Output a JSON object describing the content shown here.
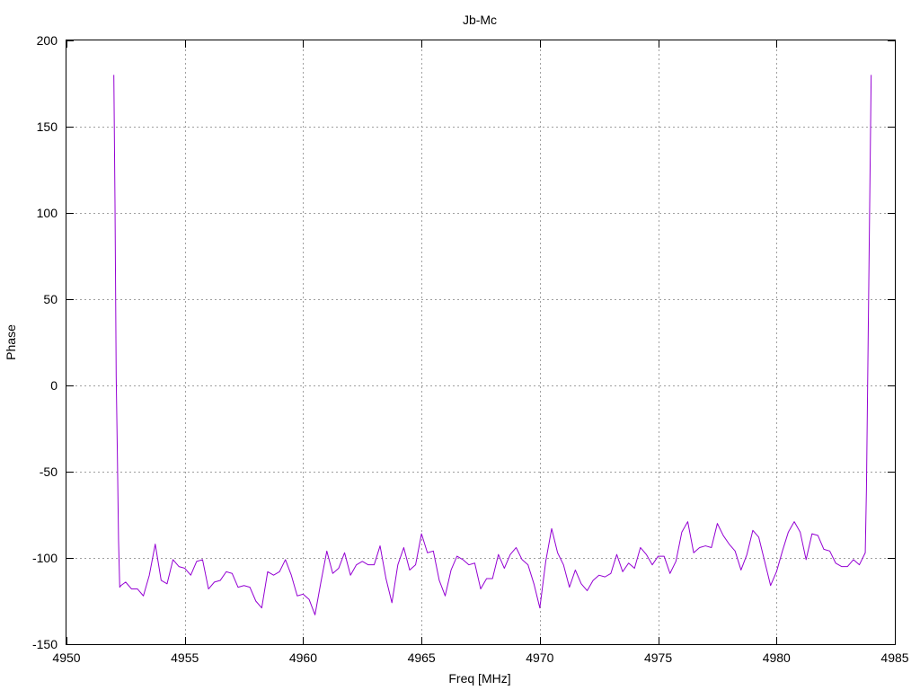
{
  "chart_data": {
    "type": "line",
    "title": "Jb-Mc",
    "xlabel": "Freq [MHz]",
    "ylabel": "Phase",
    "xlim": [
      4950,
      4985
    ],
    "ylim": [
      -150,
      200
    ],
    "xticks": [
      4950,
      4955,
      4960,
      4965,
      4970,
      4975,
      4980,
      4985
    ],
    "yticks": [
      -150,
      -100,
      -50,
      0,
      50,
      100,
      150,
      200
    ],
    "grid": true,
    "colors": {
      "series": "#9400d3",
      "grid": "#a0a0a0",
      "axis": "#000000"
    },
    "series": [
      {
        "x": [
          4952.0,
          4952.05,
          4952.1,
          4952.15,
          4952.2,
          4952.25,
          4952.3,
          4952.5,
          4952.75,
          4953.0,
          4953.25,
          4953.5,
          4953.75,
          4954.0,
          4954.25,
          4954.5,
          4954.75,
          4955.0,
          4955.25,
          4955.5,
          4955.75,
          4956.0,
          4956.25,
          4956.5,
          4956.75,
          4957.0,
          4957.25,
          4957.5,
          4957.75,
          4958.0,
          4958.25,
          4958.5,
          4958.75,
          4959.0,
          4959.25,
          4959.5,
          4959.75,
          4960.0,
          4960.25,
          4960.5,
          4960.75,
          4961.0,
          4961.25,
          4961.5,
          4961.75,
          4962.0,
          4962.25,
          4962.5,
          4962.75,
          4963.0,
          4963.25,
          4963.5,
          4963.75,
          4964.0,
          4964.25,
          4964.5,
          4964.75,
          4965.0,
          4965.25,
          4965.5,
          4965.75,
          4966.0,
          4966.25,
          4966.5,
          4966.75,
          4967.0,
          4967.25,
          4967.5,
          4967.75,
          4968.0,
          4968.25,
          4968.5,
          4968.75,
          4969.0,
          4969.25,
          4969.5,
          4969.75,
          4970.0,
          4970.25,
          4970.5,
          4970.75,
          4971.0,
          4971.25,
          4971.5,
          4971.75,
          4972.0,
          4972.25,
          4972.5,
          4972.75,
          4973.0,
          4973.25,
          4973.5,
          4973.75,
          4974.0,
          4974.25,
          4974.5,
          4974.75,
          4975.0,
          4975.25,
          4975.5,
          4975.75,
          4976.0,
          4976.25,
          4976.5,
          4976.75,
          4977.0,
          4977.25,
          4977.5,
          4977.75,
          4978.0,
          4978.25,
          4978.5,
          4978.75,
          4979.0,
          4979.25,
          4979.5,
          4979.75,
          4980.0,
          4980.25,
          4980.5,
          4980.75,
          4981.0,
          4981.25,
          4981.5,
          4981.75,
          4982.0,
          4982.25,
          4982.5,
          4982.75,
          4983.0,
          4983.25,
          4983.5,
          4983.75,
          4983.8,
          4983.85,
          4983.9,
          4983.95,
          4984.0
        ],
        "y": [
          180,
          105,
          5,
          -40,
          -90,
          -117,
          -116,
          -114,
          -118,
          -118,
          -122,
          -110,
          -92,
          -113,
          -115,
          -101,
          -105,
          -106,
          -110,
          -102,
          -101,
          -118,
          -114,
          -113,
          -108,
          -109,
          -117,
          -116,
          -117,
          -125,
          -129,
          -108,
          -110,
          -108,
          -101,
          -110,
          -122,
          -121,
          -124,
          -133,
          -114,
          -96,
          -109,
          -106,
          -97,
          -110,
          -104,
          -102,
          -104,
          -104,
          -93,
          -112,
          -126,
          -104,
          -94,
          -107,
          -104,
          -86,
          -97,
          -96,
          -113,
          -122,
          -107,
          -99,
          -101,
          -104,
          -103,
          -118,
          -112,
          -112,
          -98,
          -106,
          -98,
          -94,
          -101,
          -104,
          -115,
          -129,
          -102,
          -83,
          -97,
          -104,
          -117,
          -107,
          -115,
          -119,
          -113,
          -110,
          -111,
          -109,
          -98,
          -108,
          -103,
          -106,
          -94,
          -98,
          -104,
          -99,
          -99,
          -109,
          -102,
          -85,
          -79,
          -97,
          -94,
          -93,
          -94,
          -80,
          -87,
          -92,
          -96,
          -107,
          -98,
          -84,
          -88,
          -102,
          -116,
          -108,
          -96,
          -85,
          -79,
          -85,
          -101,
          -86,
          -87,
          -95,
          -96,
          -103,
          -105,
          -105,
          -101,
          -104,
          -97,
          -60,
          0,
          60,
          120,
          180
        ]
      }
    ]
  }
}
